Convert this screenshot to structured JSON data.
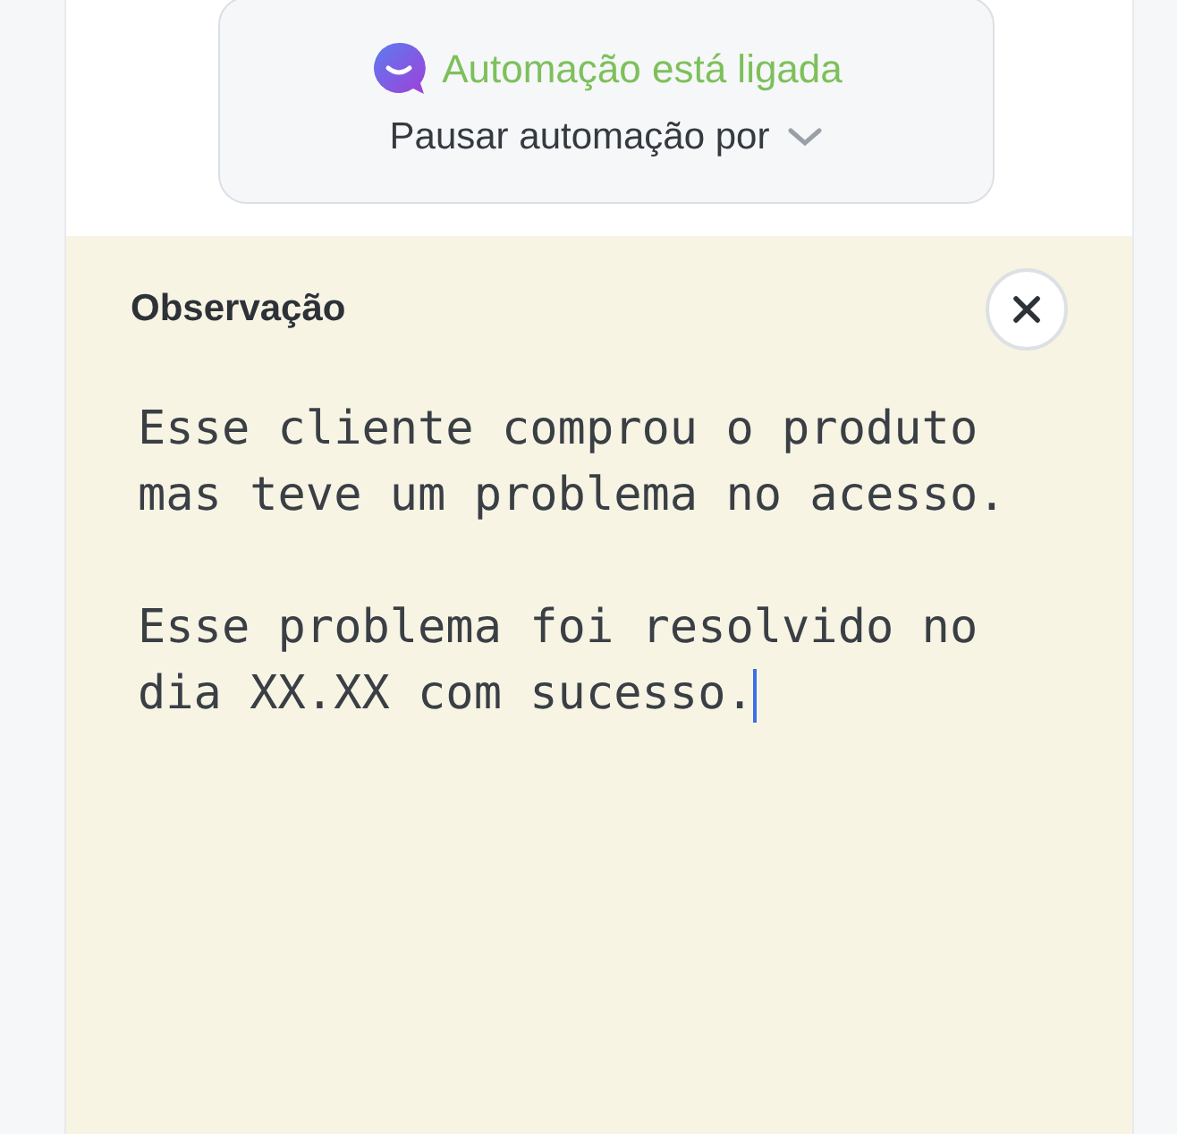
{
  "automation": {
    "status": "Automação está ligada",
    "pause_label": "Pausar automação por"
  },
  "note": {
    "title": "Observação",
    "value": "Esse cliente comprou o produto\nmas teve um problema no acesso.\n\nEsse problema foi resolvido no\ndia XX.XX com sucesso.",
    "focused": true
  }
}
